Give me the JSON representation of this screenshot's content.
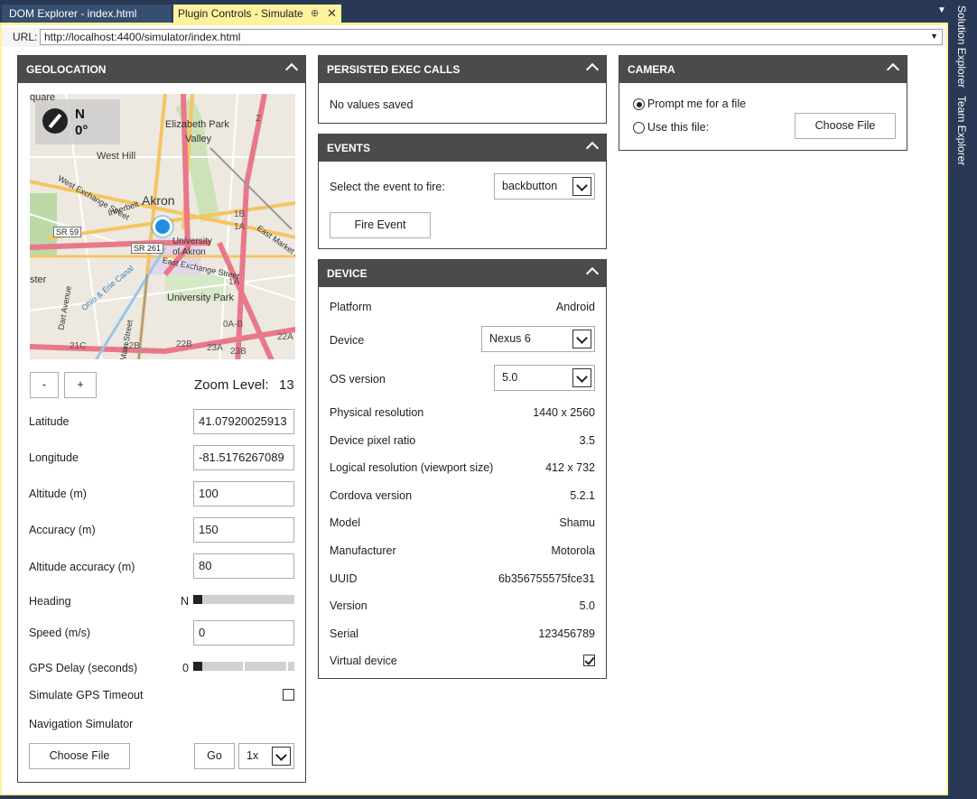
{
  "tabs": {
    "dom_explorer": "DOM Explorer - index.html",
    "plugin_controls": "Plugin Controls - Simulate",
    "pin_glyph": "⊕",
    "close_glyph": "✕"
  },
  "side_tabs": {
    "solution_explorer": "Solution Explorer",
    "team_explorer": "Team Explorer"
  },
  "url_bar": {
    "label": "URL:",
    "value": "http://localhost:4400/simulator/index.html"
  },
  "geolocation": {
    "title": "GEOLOCATION",
    "compass": {
      "direction": "N",
      "degrees": "0°"
    },
    "map_labels": {
      "elizabeth_park": "Elizabeth Park",
      "valley": "Valley",
      "west_hill": "West Hill",
      "akron": "Akron",
      "west_exchange": "West Exchange Street",
      "innerbelt": "Innerbelt",
      "sr59": "SR 59",
      "sr261": "SR 261",
      "university_of_akron": "University of Akron",
      "east_exchange": "East Exchange Street",
      "east_market": "East Market Street",
      "university_park": "University Park",
      "dart_avenue": "Dart Avenue",
      "main_street": "Main Street",
      "ohio_erie": "Ohio & Erie Canal",
      "quare": "quare",
      "ster": "ster"
    },
    "road_numbers": {
      "n2": "2",
      "n1b": "1B",
      "n1a_top": "1A",
      "n1a": "1A",
      "n0ab": "0A-B",
      "n22a": "22A",
      "n21c": "21C",
      "n22b_left": "22B",
      "n22b": "22B",
      "n23a": "23A",
      "n23b": "23B"
    },
    "zoom_out": "-",
    "zoom_in": "+",
    "zoom_label": "Zoom Level:",
    "zoom_value": "13",
    "latitude_label": "Latitude",
    "latitude_value": "41.07920025913",
    "longitude_label": "Longitude",
    "longitude_value": "-81.5176267089",
    "altitude_label": "Altitude (m)",
    "altitude_value": "100",
    "accuracy_label": "Accuracy (m)",
    "accuracy_value": "150",
    "altitude_accuracy_label": "Altitude accuracy (m)",
    "altitude_accuracy_value": "80",
    "heading_label": "Heading",
    "heading_value": "N",
    "heading_level": 0,
    "speed_label": "Speed (m/s)",
    "speed_value": "0",
    "gps_delay_label": "GPS Delay (seconds)",
    "gps_delay_value": "0",
    "gps_delay_level": 0,
    "gps_timeout_label": "Simulate GPS Timeout",
    "gps_timeout_checked": false,
    "nav_sim_label": "Navigation Simulator",
    "choose_file": "Choose File",
    "go": "Go",
    "speed_multiplier": "1x"
  },
  "persisted_exec_calls": {
    "title": "PERSISTED EXEC CALLS",
    "empty_text": "No values saved"
  },
  "events": {
    "title": "EVENTS",
    "select_label": "Select the event to fire:",
    "selected_event": "backbutton",
    "fire_button": "Fire Event"
  },
  "device": {
    "title": "DEVICE",
    "platform_label": "Platform",
    "platform_value": "Android",
    "device_label": "Device",
    "device_value": "Nexus 6",
    "os_label": "OS version",
    "os_value": "5.0",
    "rows": [
      {
        "label": "Physical resolution",
        "value": "1440 x 2560"
      },
      {
        "label": "Device pixel ratio",
        "value": "3.5"
      },
      {
        "label": "Logical resolution (viewport size)",
        "value": "412 x 732"
      },
      {
        "label": "Cordova version",
        "value": "5.2.1"
      },
      {
        "label": "Model",
        "value": "Shamu"
      },
      {
        "label": "Manufacturer",
        "value": "Motorola"
      },
      {
        "label": "UUID",
        "value": "6b356755575fce31"
      },
      {
        "label": "Version",
        "value": "5.0"
      },
      {
        "label": "Serial",
        "value": "123456789"
      }
    ],
    "virtual_device_label": "Virtual device",
    "virtual_device_checked": true
  },
  "camera": {
    "title": "CAMERA",
    "prompt_label": "Prompt me for a file",
    "use_file_label": "Use this file:",
    "choose_file": "Choose File",
    "selected_option": "prompt"
  },
  "colors": {
    "chrome_bg": "#293955",
    "active_tab": "#fff29d",
    "panel_header": "#4b4b4b",
    "map_marker": "#1e8fe0",
    "highway": "#e8788a",
    "major_road": "#f5c562"
  }
}
